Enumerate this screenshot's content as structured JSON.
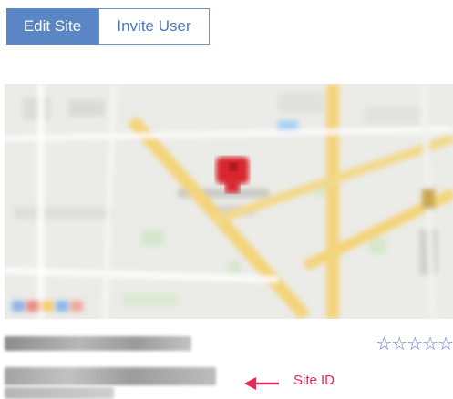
{
  "toolbar": {
    "edit_site_label": "Edit Site",
    "invite_user_label": "Invite User",
    "colors": {
      "primary": "#5b86c6",
      "outline": "#6f93cc"
    }
  },
  "map": {
    "pin_color": "#d9262e",
    "road_color": "#f4d47a"
  },
  "site": {
    "rating_stars": "☆☆☆☆☆",
    "rating_value": 0,
    "rating_max": 5
  },
  "annotation": {
    "label": "Site ID",
    "color": "#e1295c",
    "arrow_icon": "arrow-left-icon"
  }
}
